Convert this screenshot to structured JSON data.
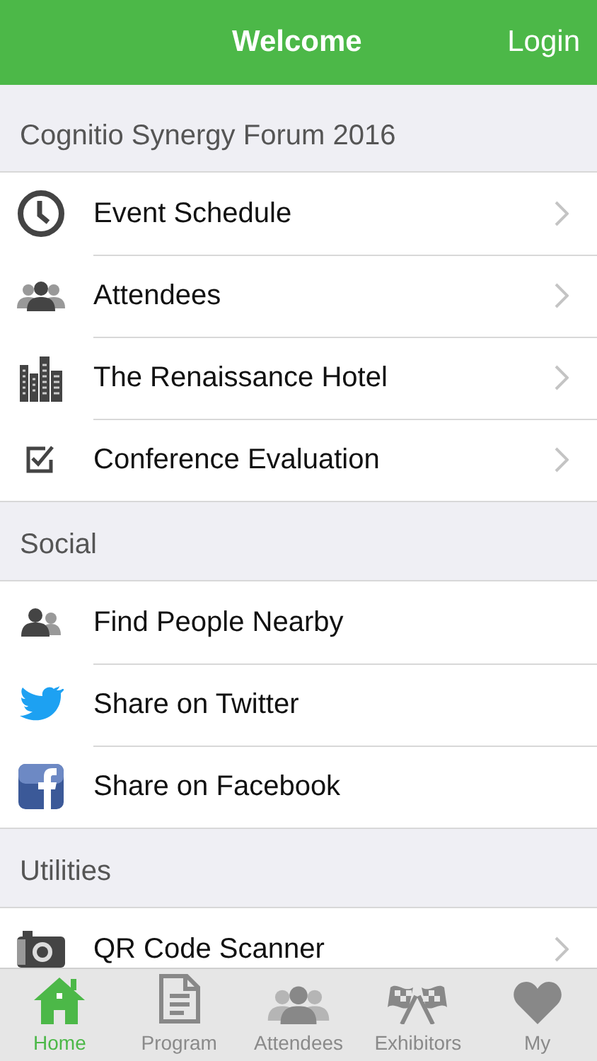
{
  "header": {
    "title": "Welcome",
    "login": "Login"
  },
  "sections": [
    {
      "title": "Cognitio Synergy Forum 2016",
      "items": [
        {
          "label": "Event Schedule",
          "chevron": true
        },
        {
          "label": "Attendees",
          "chevron": true
        },
        {
          "label": "The Renaissance Hotel",
          "chevron": true
        },
        {
          "label": "Conference Evaluation",
          "chevron": true
        }
      ]
    },
    {
      "title": "Social",
      "items": [
        {
          "label": "Find People Nearby",
          "chevron": false
        },
        {
          "label": "Share on Twitter",
          "chevron": false
        },
        {
          "label": "Share on Facebook",
          "chevron": false
        }
      ]
    },
    {
      "title": "Utilities",
      "items": [
        {
          "label": "QR Code Scanner",
          "chevron": true
        }
      ]
    }
  ],
  "tabs": [
    {
      "label": "Home",
      "selected": true
    },
    {
      "label": "Program",
      "selected": false
    },
    {
      "label": "Attendees",
      "selected": false
    },
    {
      "label": "Exhibitors",
      "selected": false
    },
    {
      "label": "My",
      "selected": false
    }
  ]
}
